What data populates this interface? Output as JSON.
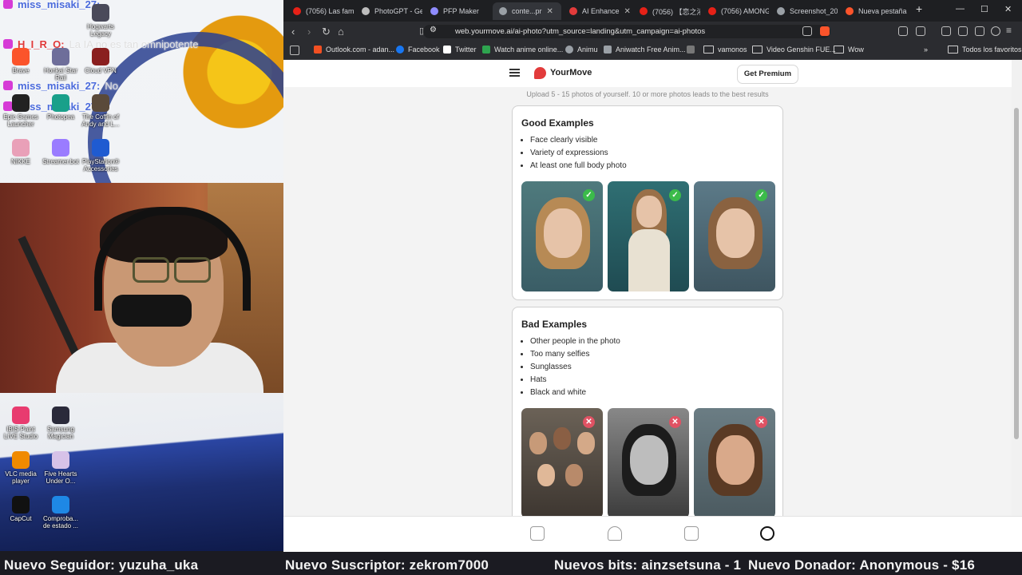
{
  "desktop": {
    "chat": [
      {
        "user": "miss_misaki_27:",
        "message": ""
      },
      {
        "user": "H_I_R_O:",
        "message": "La IA no es tan omnipotente"
      },
      {
        "user": "miss_misaki_27:",
        "message": "No"
      },
      {
        "user": "miss_misaki_27:",
        "message": ""
      }
    ],
    "icons": [
      "Hogwarts Legacy",
      "Brave",
      "Honkai Star Rail",
      "Cloud VPN",
      "Epic Games Launcher",
      "Photopea",
      "The Coffin of Andy and L...",
      "NIKKE",
      "Streamer.bot",
      "PlayStation® Accessories",
      "IBIS Paint LIVE Studio",
      "Samsung Magician",
      "VLC media player",
      "Five Hearts Under O...",
      "CapCut",
      "Comproba... de estado ..."
    ]
  },
  "ticker": {
    "follower": "Nuevo Seguidor: yuzuha_uka",
    "subscriber": "Nuevo Suscriptor: zekrom7000",
    "bits": "Nuevos bits: ainzsetsuna - 1",
    "donor": "Nuevo Donador: Anonymous - $16"
  },
  "browser": {
    "tabs": [
      {
        "label": "(7056) Las fam",
        "color": "#e62117"
      },
      {
        "label": "PhotoGPT - Ge",
        "color": "#bdbdbd"
      },
      {
        "label": "PFP Maker",
        "color": "#8f8cff"
      },
      {
        "label": "conte...pr",
        "color": "#9aa0a6",
        "active": true
      },
      {
        "label": "AI Enhance",
        "color": "#e23b3b"
      },
      {
        "label": "(7056) 【恋之渚",
        "color": "#e62117"
      },
      {
        "label": "(7056) AMONG",
        "color": "#e62117"
      },
      {
        "label": "Screenshot_20",
        "color": "#9aa0a6"
      },
      {
        "label": "Nueva pestaña",
        "color": "#fb542b"
      }
    ],
    "url": "web.yourmove.ai/ai-photo?utm_source=landing&utm_campaign=ai-photos",
    "bookmarks": [
      "Outlook.com - adan...",
      "Facebook",
      "Twitter",
      "Watch anime online...",
      "Animu",
      "Aniwatch Free Anim...",
      "vamonos",
      "Video Genshin FUE...",
      "Wow"
    ],
    "bookmarks_right": "Todos los favoritos"
  },
  "app": {
    "brand": "YourMove",
    "premium_label": "Get Premium",
    "hint": "Upload 5 - 15 photos of yourself. 10 or more photos leads to the best results",
    "good": {
      "title": "Good Examples",
      "items": [
        "Face clearly visible",
        "Variety of expressions",
        "At least one full body photo"
      ]
    },
    "bad": {
      "title": "Bad Examples",
      "items": [
        "Other people in the photo",
        "Too many selfies",
        "Sunglasses",
        "Hats",
        "Black and white"
      ]
    }
  }
}
